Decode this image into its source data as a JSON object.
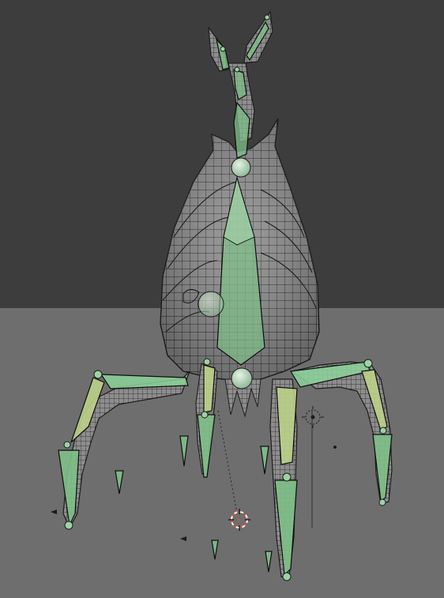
{
  "viewport": {
    "kind": "3d-viewport",
    "mode": "wireframe-over-solid",
    "object": "creature-mesh-with-armature"
  },
  "colors": {
    "sky": "#3d3d3d",
    "ground": "#6e6e6e",
    "mesh_fill": "#8c8c8c",
    "mesh_wire": "#1c1c1c",
    "bone_fill": "#7fbf88",
    "bone_selected": "#bcd08a",
    "bone_outline": "#0d0d0d",
    "joint": "#9dd3a4",
    "cursor_red": "#e34d3d",
    "cursor_white": "#ffffff"
  },
  "icons": [
    "3d-cursor-icon",
    "light-probe-icon"
  ]
}
